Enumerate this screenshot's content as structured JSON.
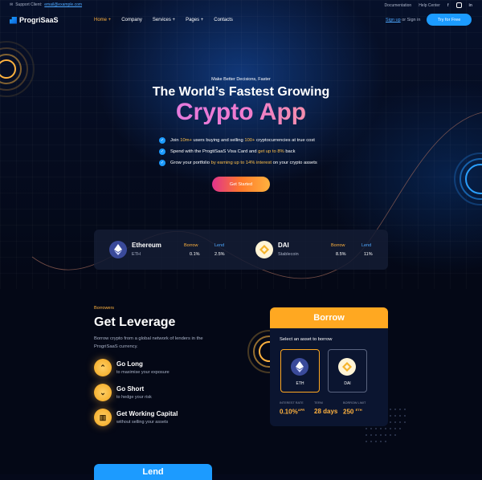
{
  "topbar": {
    "support_label": "Support Client:",
    "support_email": "email@example.com",
    "documentation": "Documentation",
    "help_center": "Help Center"
  },
  "nav": {
    "logo": "ProgriSaaS",
    "items": [
      "Home +",
      "Company",
      "Services +",
      "Pages +",
      "Contacts"
    ],
    "signup": "Sign up",
    "or_signin": "or Sign in",
    "try_free": "Try for Free"
  },
  "hero": {
    "kicker": "Make Better Decisions, Faster",
    "title": "The World’s Fastest Growing",
    "big": "Crypto App",
    "bullets": [
      {
        "pre": "Join ",
        "hl1": "10m+",
        "mid": " users buying and selling ",
        "hl2": "100+",
        "post": " cryptocurrencies at true cost"
      },
      {
        "pre": "Spend with the ProgtiSaaS Visa Card and ",
        "hl1": "get up to 8%",
        "mid": " back",
        "hl2": "",
        "post": ""
      },
      {
        "pre": "Grow your portfolio ",
        "hl1": "by earning up to 14% interest",
        "mid": " on your crypto assets",
        "hl2": "",
        "post": ""
      }
    ],
    "cta": "Get Started"
  },
  "rates": {
    "eth": {
      "name": "Ethereum",
      "symbol": "ETH",
      "borrow_label": "Borrow",
      "borrow": "0.1%",
      "lend_label": "Lend",
      "lend": "2.5%"
    },
    "dai": {
      "name": "DAI",
      "symbol": "Stablecoin",
      "borrow_label": "Borrow",
      "borrow": "8.5%",
      "lend_label": "Lend",
      "lend": "11%"
    }
  },
  "leverage": {
    "kicker": "Borrowers",
    "title": "Get Leverage",
    "desc": "Borrow crypto from a global network of lenders in the ProgriSaaS currency.",
    "features": [
      {
        "title": "Go Long",
        "desc": "to maximise your exposure"
      },
      {
        "title": "Go Short",
        "desc": "to hedge your risk"
      },
      {
        "title": "Get Working Capital",
        "desc": "without selling your assets"
      }
    ]
  },
  "borrow_panel": {
    "title": "Borrow",
    "subtitle": "Select an asset to borrow",
    "assets": [
      "ETH",
      "DAI"
    ],
    "stats": [
      {
        "label": "INTEREST RATE",
        "value": "0.10%",
        "unit": "APR"
      },
      {
        "label": "TERM",
        "value": "28 days",
        "unit": ""
      },
      {
        "label": "BORROW LIMIT",
        "value": "250",
        "unit": "ETH"
      }
    ]
  },
  "lend_panel": {
    "title": "Lend"
  },
  "colors": {
    "accent_orange": "#ffa821",
    "accent_blue": "#1c9bff",
    "background": "#05091a"
  }
}
